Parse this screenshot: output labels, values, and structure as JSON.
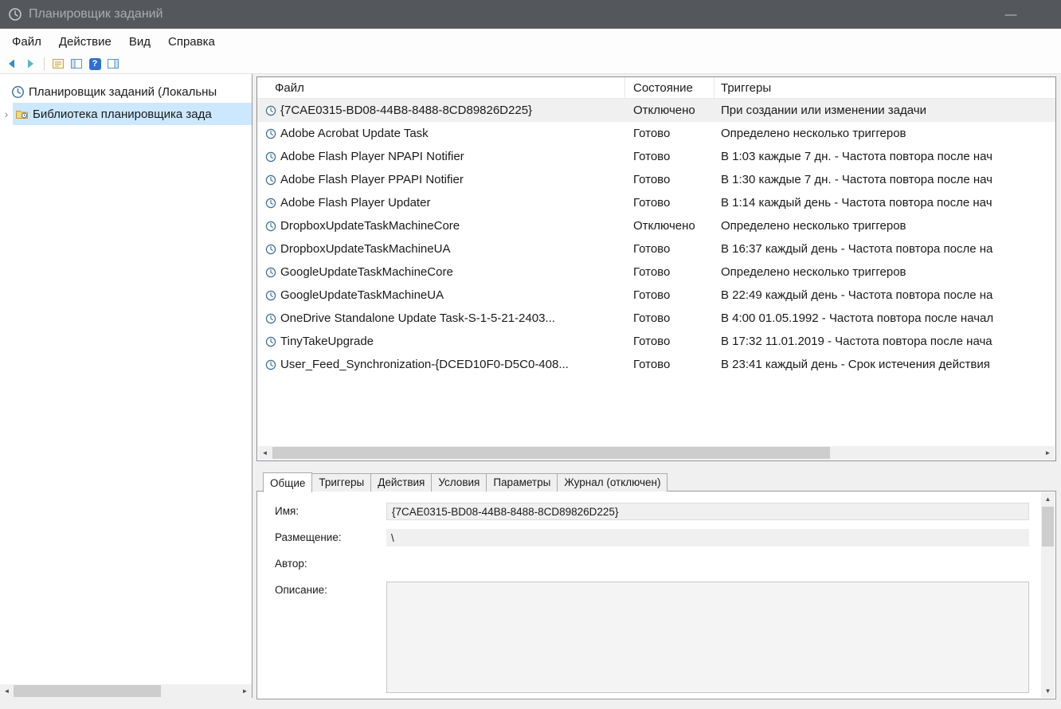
{
  "window": {
    "title": "Планировщик заданий",
    "minimize_glyph": "—"
  },
  "menubar": {
    "items": [
      {
        "label": "Файл"
      },
      {
        "label": "Действие"
      },
      {
        "label": "Вид"
      },
      {
        "label": "Справка"
      }
    ]
  },
  "toolbar": {
    "icons": [
      "back-arrow",
      "forward-arrow",
      "show-hide-console-tree",
      "export-list",
      "help",
      "show-hide-action-pane"
    ],
    "help_glyph": "?"
  },
  "tree": {
    "items": [
      {
        "label": "Планировщик заданий (Локальны",
        "selected": false
      },
      {
        "label": "Библиотека планировщика зада",
        "selected": true
      }
    ],
    "chevron_glyph": "›"
  },
  "tasks": {
    "columns": [
      {
        "label": "Файл"
      },
      {
        "label": "Состояние"
      },
      {
        "label": "Триггеры"
      }
    ],
    "rows": [
      {
        "name": "{7CAE0315-BD08-44B8-8488-8CD89826D225}",
        "status": "Отключено",
        "trigger": "При создании или изменении задачи",
        "selected": true
      },
      {
        "name": "Adobe Acrobat Update Task",
        "status": "Готово",
        "trigger": "Определено несколько триггеров"
      },
      {
        "name": "Adobe Flash Player NPAPI Notifier",
        "status": "Готово",
        "trigger": "В 1:03 каждые 7 дн. - Частота повтора после нач"
      },
      {
        "name": "Adobe Flash Player PPAPI Notifier",
        "status": "Готово",
        "trigger": "В 1:30 каждые 7 дн. - Частота повтора после нач"
      },
      {
        "name": "Adobe Flash Player Updater",
        "status": "Готово",
        "trigger": "В 1:14 каждый день - Частота повтора после нач"
      },
      {
        "name": "DropboxUpdateTaskMachineCore",
        "status": "Отключено",
        "trigger": "Определено несколько триггеров"
      },
      {
        "name": "DropboxUpdateTaskMachineUA",
        "status": "Готово",
        "trigger": "В 16:37 каждый день - Частота повтора после на"
      },
      {
        "name": "GoogleUpdateTaskMachineCore",
        "status": "Готово",
        "trigger": "Определено несколько триггеров"
      },
      {
        "name": "GoogleUpdateTaskMachineUA",
        "status": "Готово",
        "trigger": "В 22:49 каждый день - Частота повтора после на"
      },
      {
        "name": "OneDrive Standalone Update Task-S-1-5-21-2403...",
        "status": "Готово",
        "trigger": "В 4:00 01.05.1992 - Частота повтора после начал"
      },
      {
        "name": "TinyTakeUpgrade",
        "status": "Готово",
        "trigger": "В 17:32 11.01.2019 - Частота повтора после нача"
      },
      {
        "name": "User_Feed_Synchronization-{DCED10F0-D5C0-408...",
        "status": "Готово",
        "trigger": "В 23:41 каждый день - Срок истечения действия"
      }
    ]
  },
  "details": {
    "tabs": [
      {
        "label": "Общие",
        "active": true
      },
      {
        "label": "Триггеры",
        "active": false
      },
      {
        "label": "Действия",
        "active": false
      },
      {
        "label": "Условия",
        "active": false
      },
      {
        "label": "Параметры",
        "active": false
      },
      {
        "label": "Журнал (отключен)",
        "active": false
      }
    ],
    "fields": {
      "name_label": "Имя:",
      "name_value": "{7CAE0315-BD08-44B8-8488-8CD89826D225}",
      "location_label": "Размещение:",
      "location_value": "\\",
      "author_label": "Автор:",
      "author_value": "",
      "description_label": "Описание:"
    }
  },
  "scrollbars": {
    "left_glyph": "◄",
    "right_glyph": "►",
    "up_glyph": "▲",
    "down_glyph": "▼"
  },
  "colors": {
    "titlebar_bg": "#54585c",
    "tree_selection": "#cce8ff",
    "selected_row": "#f0f0f0",
    "panel_border": "#8e9094"
  }
}
